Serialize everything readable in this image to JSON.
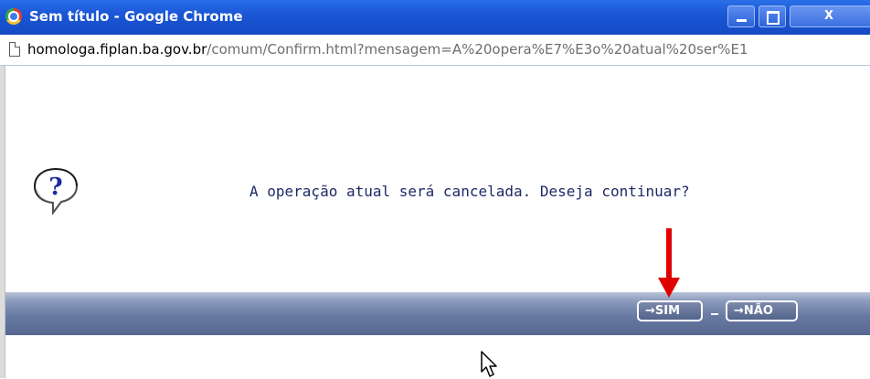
{
  "window": {
    "title": "Sem título - Google Chrome",
    "min_label": "–",
    "max_label": "□",
    "close_label": "X"
  },
  "address": {
    "host": "homologa.fiplan.ba.gov.br",
    "path": "/comum/Confirm.html?mensagem=A%20opera%E7%E3o%20atual%20ser%E1"
  },
  "dialog": {
    "message": "A operação atual será cancelada. Deseja continuar?",
    "icon": "question-icon"
  },
  "buttons": {
    "yes": "→SIM",
    "no": "→NÃO"
  },
  "colors": {
    "titlebar": "#1a56d6",
    "action_bar": "#687aa3",
    "annotation_arrow": "#e00000",
    "message_text": "#1e2a66"
  }
}
